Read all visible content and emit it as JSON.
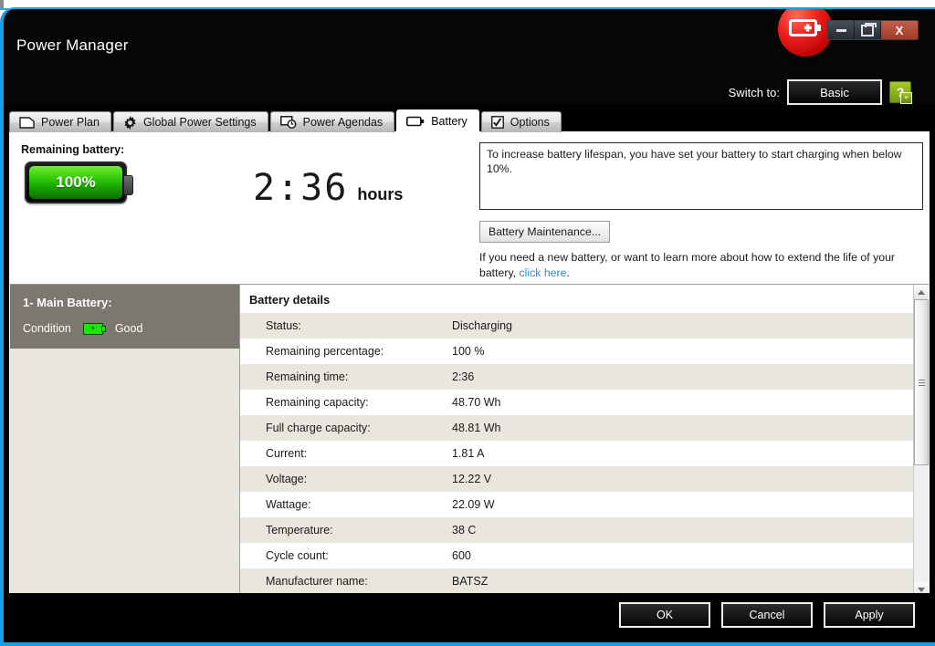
{
  "window": {
    "title": "Power Manager",
    "badge_icon": "battery-plus-icon",
    "minimize_label": "Minimize",
    "maximize_label": "Restore",
    "close_label": "X"
  },
  "header": {
    "switch_label": "Switch to:",
    "switch_button": "Basic",
    "help_icon": "help-question-icon",
    "help_glyph": "?"
  },
  "tabs": [
    {
      "label": "Power Plan",
      "icon": "document-icon",
      "active": false
    },
    {
      "label": "Global Power Settings",
      "icon": "gear-icon",
      "active": false
    },
    {
      "label": "Power Agendas",
      "icon": "monitor-clock-icon",
      "active": false
    },
    {
      "label": "Battery",
      "icon": "battery-icon",
      "active": true
    },
    {
      "label": "Options",
      "icon": "checkbox-icon",
      "active": false
    }
  ],
  "summary": {
    "remaining_label": "Remaining battery:",
    "percent": "100%",
    "time_value": "2:36",
    "time_unit": "hours",
    "info_text": "To increase battery lifespan, you have set your battery to start charging when below 10%.",
    "maintenance_button": "Battery Maintenance...",
    "footnote_text": "If you need a new battery, or want to learn more about how to extend the life of your battery, ",
    "footnote_link": "click here",
    "footnote_tail": "."
  },
  "sidebar": {
    "battery_name": "1- Main Battery:",
    "condition_label": "Condition",
    "condition_value": "Good",
    "condition_icon": "battery-good-icon"
  },
  "details": {
    "title": "Battery details",
    "rows": [
      {
        "key": "Status:",
        "value": "Discharging"
      },
      {
        "key": "Remaining percentage:",
        "value": "100 %"
      },
      {
        "key": "Remaining time:",
        "value": "2:36"
      },
      {
        "key": "Remaining capacity:",
        "value": "48.70 Wh"
      },
      {
        "key": "Full charge capacity:",
        "value": "48.81 Wh"
      },
      {
        "key": "Current:",
        "value": "1.81 A"
      },
      {
        "key": "Voltage:",
        "value": "12.22 V"
      },
      {
        "key": "Wattage:",
        "value": "22.09 W"
      },
      {
        "key": "Temperature:",
        "value": "38 C"
      },
      {
        "key": "Cycle count:",
        "value": "600"
      },
      {
        "key": "Manufacturer name:",
        "value": "BATSZ"
      }
    ]
  },
  "footer": {
    "ok": "OK",
    "cancel": "Cancel",
    "apply": "Apply"
  },
  "colors": {
    "window_border": "#1b9de0",
    "titlebar": "#060606",
    "accent_green": "#19e800",
    "badge_red": "#ef2020",
    "link": "#2e8bc7",
    "row_alt": "#e9e6dd",
    "sidebar_card": "#7c7870"
  }
}
